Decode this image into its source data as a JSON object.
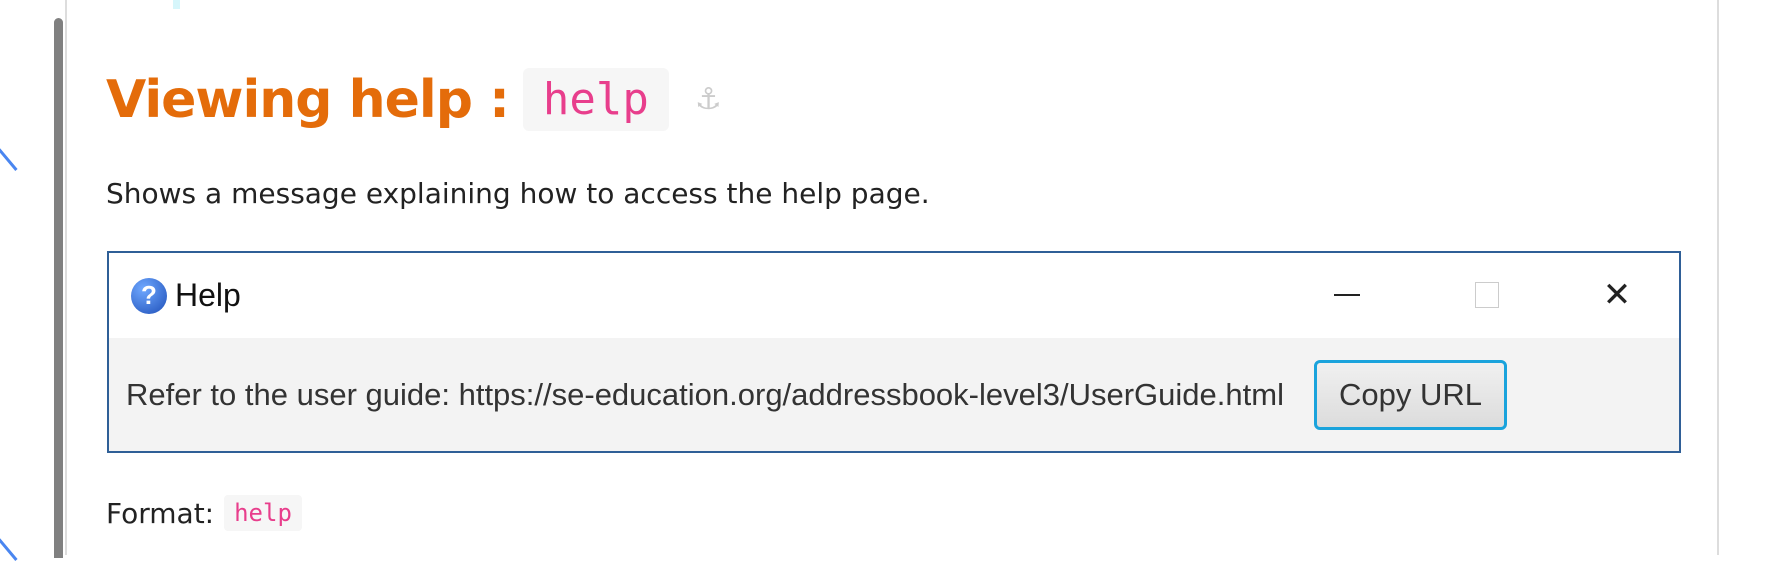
{
  "heading": {
    "text": "Viewing help :",
    "code": "help",
    "anchor_icon": "anchor-icon"
  },
  "description": "Shows a message explaining how to access the help page.",
  "dialog": {
    "icon": "question-icon",
    "title": "Help",
    "minimize_icon": "minimize-icon",
    "maximize_icon": "maximize-icon",
    "close_icon": "close-icon",
    "message": "Refer to the user guide: https://se-education.org/addressbook-level3/UserGuide.html",
    "button_label": "Copy URL"
  },
  "format": {
    "label": "Format:",
    "code": "help"
  },
  "colors": {
    "heading": "#e46c0a",
    "code": "#e83e8c",
    "dialog_border": "#2f5f97",
    "button_focus": "#1aa3dc"
  }
}
